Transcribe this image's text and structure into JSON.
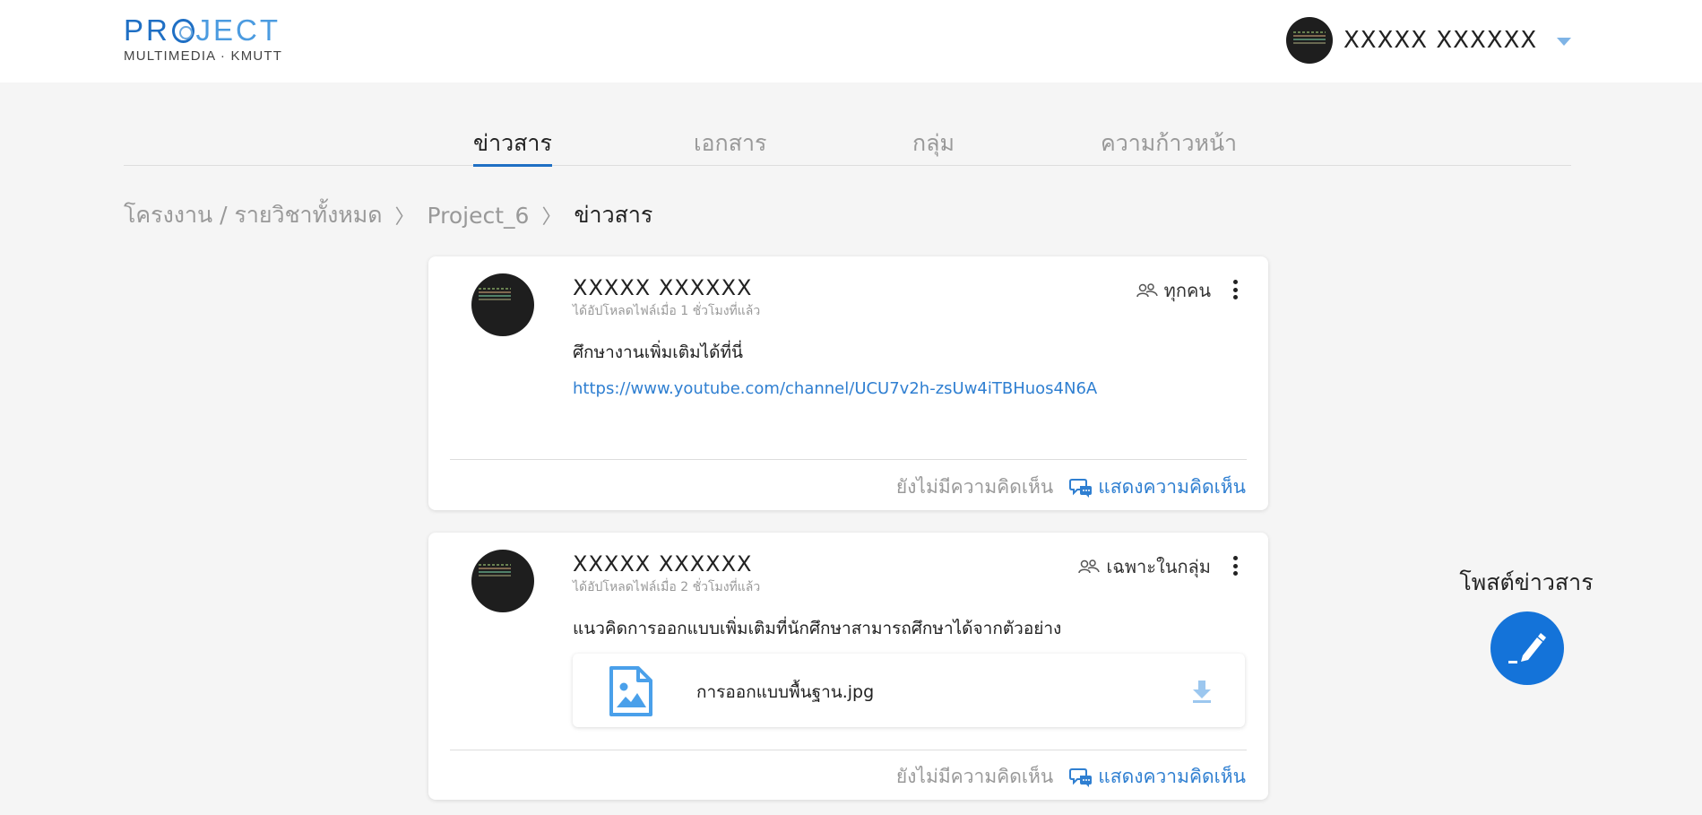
{
  "header": {
    "logo_top_p": "PR",
    "logo_top_rest": "JECT",
    "logo_bottom": "MULTIMEDIA · KMUTT",
    "user_name": "XXXXX XXXXXX"
  },
  "tabs": [
    {
      "label": "ข่าวสาร",
      "active": true
    },
    {
      "label": "เอกสาร",
      "active": false
    },
    {
      "label": "กลุ่ม",
      "active": false
    },
    {
      "label": "ความก้าวหน้า",
      "active": false
    }
  ],
  "breadcrumb": {
    "root": "โครงงาน / รายวิชาทั้งหมด",
    "project": "Project_6",
    "current": "ข่าวสาร",
    "separator": "〉"
  },
  "posts": [
    {
      "author": "XXXXX XXXXXX",
      "time": "ได้อัปโหลดไฟล์เมื่อ 1 ชั่วโมงที่แล้ว",
      "audience": "ทุกคน",
      "text": "ศึกษางานเพิ่มเติมได้ที่นี่",
      "link": "https://www.youtube.com/channel/UCU7v2h-zsUw4iTBHuos4N6A",
      "no_comment": "ยังไม่มีความคิดเห็น",
      "comment_label": "แสดงความคิดเห็น"
    },
    {
      "author": "XXXXX XXXXXX",
      "time": "ได้อัปโหลดไฟล์เมื่อ 2 ชั่วโมงที่แล้ว",
      "audience": "เฉพาะในกลุ่ม",
      "text": "แนวคิดการออกแบบเพิ่มเติมที่นักศึกษาสามารถศึกษาได้จากตัวอย่าง",
      "attachment": "การออกแบบพื้นฐาน.jpg",
      "no_comment": "ยังไม่มีความคิดเห็น",
      "comment_label": "แสดงความคิดเห็น"
    }
  ],
  "post_news": {
    "label": "โพสต์ข่าวสาร"
  },
  "colors": {
    "accent": "#1f6fc4",
    "link": "#2f7fd1",
    "fab": "#1473d9",
    "background": "#f5f5f5"
  },
  "icons": {
    "audience_all": "group-icon",
    "audience_group": "group-icon",
    "comment": "comment-bubble-icon",
    "file": "image-file-icon",
    "download": "download-icon",
    "post": "pen-icon",
    "menu": "kebab-menu-icon",
    "dropdown": "chevron-down-icon"
  }
}
